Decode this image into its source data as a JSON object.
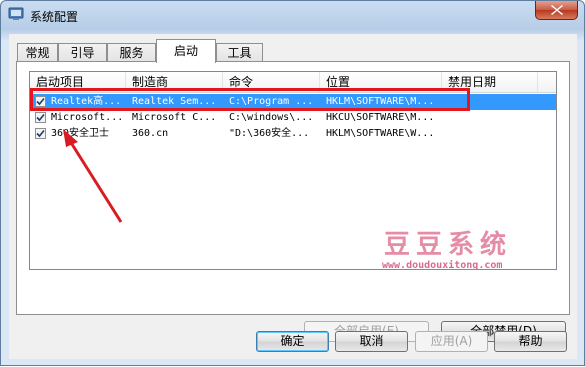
{
  "window": {
    "title": "系统配置"
  },
  "tabs": [
    {
      "label": "常规"
    },
    {
      "label": "引导"
    },
    {
      "label": "服务"
    },
    {
      "label": "启动",
      "active": true
    },
    {
      "label": "工具"
    }
  ],
  "startup_table": {
    "columns": [
      "启动项目",
      "制造商",
      "命令",
      "位置",
      "禁用日期"
    ],
    "rows": [
      {
        "checked": true,
        "item": "Realtek高...",
        "maker": "Realtek Sem...",
        "command": "C:\\Program ...",
        "location": "HKLM\\SOFTWARE\\M...",
        "disabled_date": "",
        "selected": true
      },
      {
        "checked": true,
        "item": "Microsoft...",
        "maker": "Microsoft C...",
        "command": "C:\\windows\\...",
        "location": "HKCU\\SOFTWARE\\M...",
        "disabled_date": ""
      },
      {
        "checked": true,
        "item": "360安全卫士",
        "maker": "360.cn",
        "command": "\"D:\\360安全...",
        "location": "HKLM\\SOFTWARE\\W...",
        "disabled_date": ""
      }
    ]
  },
  "buttons": {
    "enable_all": "全部启用(E)",
    "disable_all": "全部禁用(D)",
    "ok": "确定",
    "cancel": "取消",
    "apply": "应用(A)",
    "help": "帮助"
  },
  "watermark": {
    "text": "豆豆系统",
    "url": "www.doudouxitong.com"
  },
  "colors": {
    "selection": "#3399ff",
    "highlight_box": "#e3161e",
    "arrow": "#d91c23",
    "watermark": "#e58ca7"
  }
}
